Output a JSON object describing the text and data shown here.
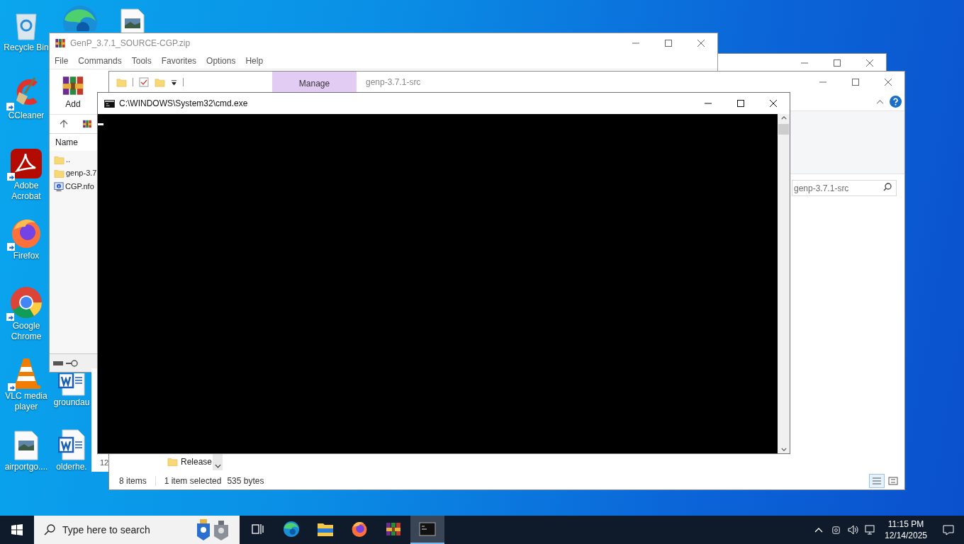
{
  "desktop_icons": [
    {
      "label": "Recycle Bin",
      "kind": "recycle",
      "shortcut": false
    },
    {
      "label": "CCleaner",
      "kind": "ccleaner",
      "shortcut": true
    },
    {
      "label": "Adobe Acrobat",
      "kind": "acrobat",
      "shortcut": true
    },
    {
      "label": "Firefox",
      "kind": "firefox",
      "shortcut": true
    },
    {
      "label": "Google Chrome",
      "kind": "chrome",
      "shortcut": true
    },
    {
      "label": "VLC media player",
      "kind": "vlc",
      "shortcut": true
    },
    {
      "label": "airportgo....",
      "kind": "image",
      "shortcut": false
    },
    {
      "kind": "edge",
      "shortcut": false
    },
    {
      "kind": "image",
      "shortcut": false
    },
    {
      "label": "groundau",
      "kind": "word",
      "shortcut": false
    },
    {
      "label": "olderhe.",
      "kind": "word",
      "shortcut": false
    }
  ],
  "archiver_window": {
    "title": "GenP_3.7.1_SOURCE-CGP.zip",
    "menu": [
      "File",
      "Commands",
      "Tools",
      "Favorites",
      "Options",
      "Help"
    ],
    "toolbar": [
      {
        "label": "Add"
      }
    ],
    "column_header": "Name",
    "rows": [
      {
        "name": "..",
        "kind": "folder"
      },
      {
        "name": "genp-3.7",
        "kind": "folder"
      },
      {
        "name": "CGP.nfo",
        "kind": "info"
      }
    ]
  },
  "explorer_window": {
    "title": "genp-3.7.1-src",
    "ribbon_tab": "Manage",
    "search": {
      "placeholder": "genp-3.7.1-src"
    },
    "files": [
      {
        "name": "Release",
        "kind": "folder"
      }
    ],
    "status": {
      "count": "8 items",
      "selection": "1 item selected",
      "size": "535 bytes"
    }
  },
  "side_panel": {
    "text": "12"
  },
  "console_window": {
    "title": "C:\\WINDOWS\\System32\\cmd.exe"
  },
  "taskbar": {
    "search": {
      "placeholder": "Type here to search"
    },
    "apps": [
      {
        "kind": "task-view",
        "selected": false
      },
      {
        "kind": "edge",
        "selected": false
      },
      {
        "kind": "explorer",
        "selected": false
      },
      {
        "kind": "firefox",
        "selected": false
      },
      {
        "kind": "winrar",
        "selected": false
      },
      {
        "kind": "cmd",
        "selected": true
      }
    ],
    "time": "11:15 PM",
    "date": "12/14/2025"
  }
}
